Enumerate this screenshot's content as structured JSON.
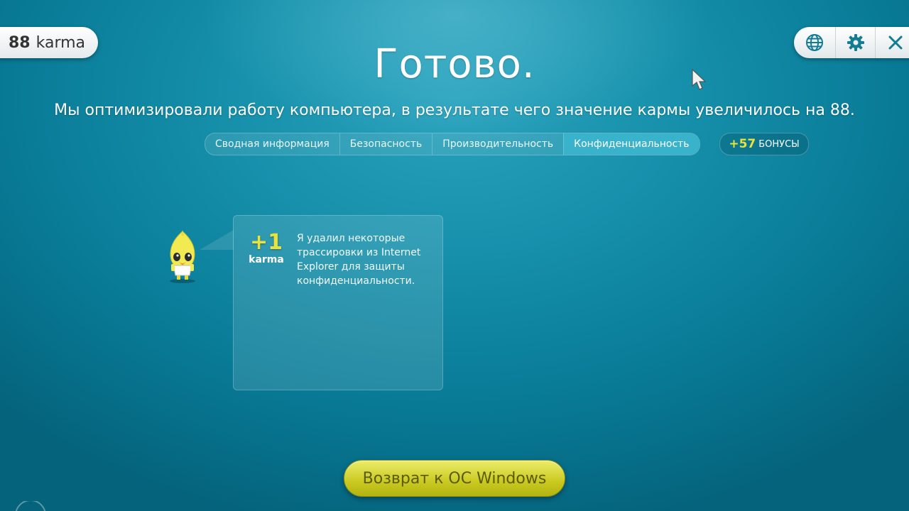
{
  "karma": {
    "value": "88",
    "label": "karma"
  },
  "header": {
    "title": "Готово.",
    "subtitle": "Мы оптимизировали работу компьютера, в результате чего значение кармы увеличилось на 88."
  },
  "top_buttons": [
    {
      "icon": "globe-icon"
    },
    {
      "icon": "gear-icon"
    },
    {
      "icon": "close-icon"
    }
  ],
  "tabs": [
    {
      "label": "Сводная информация",
      "active": false
    },
    {
      "label": "Безопасность",
      "active": false
    },
    {
      "label": "Производительность",
      "active": false
    },
    {
      "label": "Конфиденциальность",
      "active": true
    }
  ],
  "bonus": {
    "value": "+57",
    "label": "БОНУСЫ"
  },
  "card": {
    "points": "+1",
    "points_label": "karma",
    "text": "Я удалил некоторые трассировки из Internet Explorer для защиты конфиденциальности."
  },
  "footer": {
    "return_label": "Возврат к ОС Windows"
  },
  "colors": {
    "accent_yellow": "#e8e23a",
    "button_yellow": "#c9c920",
    "background": "#1690ab"
  }
}
